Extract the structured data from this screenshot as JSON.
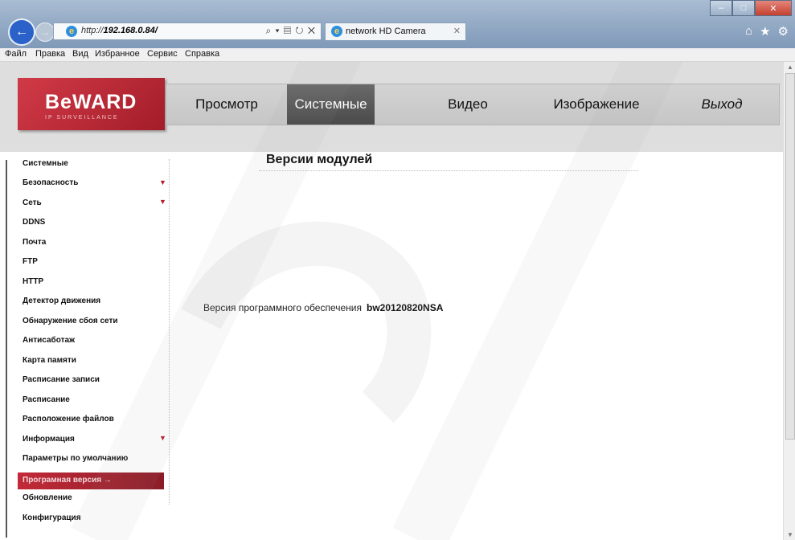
{
  "browser": {
    "url_prefix": "http://",
    "url_host": "192.168.0.84/",
    "address_tools": "⌕ ▾ ▤ ↻ ✕",
    "tab_title": "network HD Camera",
    "menu": [
      "Файл",
      "Правка",
      "Вид",
      "Избранное",
      "Сервис",
      "Справка"
    ]
  },
  "logo": {
    "name": "BeWARD",
    "sub": "IP SURVEILLANCE"
  },
  "nav": {
    "items": [
      {
        "label": "Просмотр"
      },
      {
        "label": "Системные"
      },
      {
        "label": "Видео"
      },
      {
        "label": "Изображение"
      },
      {
        "label": "Выход"
      }
    ],
    "active": "Системные"
  },
  "sidebar": {
    "items": [
      {
        "label": "Системные"
      },
      {
        "label": "Безопасность"
      },
      {
        "label": "Сеть"
      },
      {
        "label": "DDNS"
      },
      {
        "label": "Почта"
      },
      {
        "label": "FTP"
      },
      {
        "label": "HTTP"
      },
      {
        "label": "Детектор движения"
      },
      {
        "label": "Обнаружение сбоя сети"
      },
      {
        "label": "Антисаботаж"
      },
      {
        "label": "Карта памяти"
      },
      {
        "label": "Расписание записи"
      },
      {
        "label": "Расписание"
      },
      {
        "label": "Расположение файлов"
      },
      {
        "label": "Информация"
      },
      {
        "label": "Параметры по умолчанию"
      },
      {
        "label": "Програмная версия →"
      },
      {
        "label": "Обновление"
      },
      {
        "label": "Конфигурация"
      }
    ],
    "active": "Програмная версия →"
  },
  "main": {
    "title": "Версии модулей",
    "version_label": "Версия программного обеспечения",
    "version_value": "bw20120820NSA"
  },
  "colors": {
    "brand_red": "#b31b2b",
    "active_nav": "#555555"
  }
}
